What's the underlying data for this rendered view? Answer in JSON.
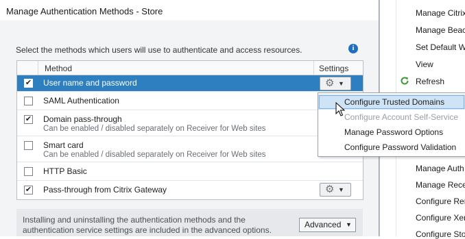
{
  "right_pane": {
    "items": [
      {
        "label": "Manage Citrix"
      },
      {
        "label": "Manage Beac"
      },
      {
        "label": "Set Default W"
      },
      {
        "label": "View"
      },
      {
        "label": "Refresh"
      },
      {
        "label": "Manage Auth"
      },
      {
        "label": "Manage Rece"
      },
      {
        "label": "Configure Rer"
      },
      {
        "label": "Configure Xer"
      },
      {
        "label": "Configure Stor"
      }
    ]
  },
  "dialog": {
    "title": "Manage Authentication Methods - Store",
    "instruction": "Select the methods which users will use to authenticate and access resources.",
    "table": {
      "headers": {
        "method": "Method",
        "settings": "Settings"
      },
      "rows": [
        {
          "label": "User name and password",
          "sub": "",
          "checked": "✔",
          "selected": true,
          "has_settings": true
        },
        {
          "label": "SAML Authentication",
          "sub": "",
          "checked": "",
          "selected": false,
          "has_settings": false
        },
        {
          "label": "Domain pass-through",
          "sub": "Can be enabled / disabled separately on Receiver for Web sites",
          "checked": "✔",
          "selected": false,
          "has_settings": false
        },
        {
          "label": "Smart card",
          "sub": "Can be enabled / disabled separately on Receiver for Web sites",
          "checked": "",
          "selected": false,
          "has_settings": false
        },
        {
          "label": "HTTP Basic",
          "sub": "",
          "checked": "",
          "selected": false,
          "has_settings": false
        },
        {
          "label": "Pass-through from Citrix Gateway",
          "sub": "",
          "checked": "✔",
          "selected": false,
          "has_settings": true
        }
      ]
    },
    "footer": {
      "text": "Installing and uninstalling the authentication methods and the authentication service settings are included in the advanced options.",
      "advanced_label": "Advanced"
    }
  },
  "popup_menu": {
    "items": [
      {
        "label": "Configure Trusted Domains",
        "state": "hover"
      },
      {
        "label": "Configure Account Self-Service",
        "state": "disabled"
      },
      {
        "label": "Manage Password Options",
        "state": "normal"
      },
      {
        "label": "Configure Password Validation",
        "state": "normal"
      }
    ]
  },
  "icons": {
    "gear": "gear-icon",
    "dropdown": "chevron-down-icon",
    "info": "info-icon",
    "refresh": "refresh-icon"
  },
  "colors": {
    "selection": "#2e7fbf",
    "menu_hover": "#cfe3f6",
    "info": "#1f6fbf"
  }
}
